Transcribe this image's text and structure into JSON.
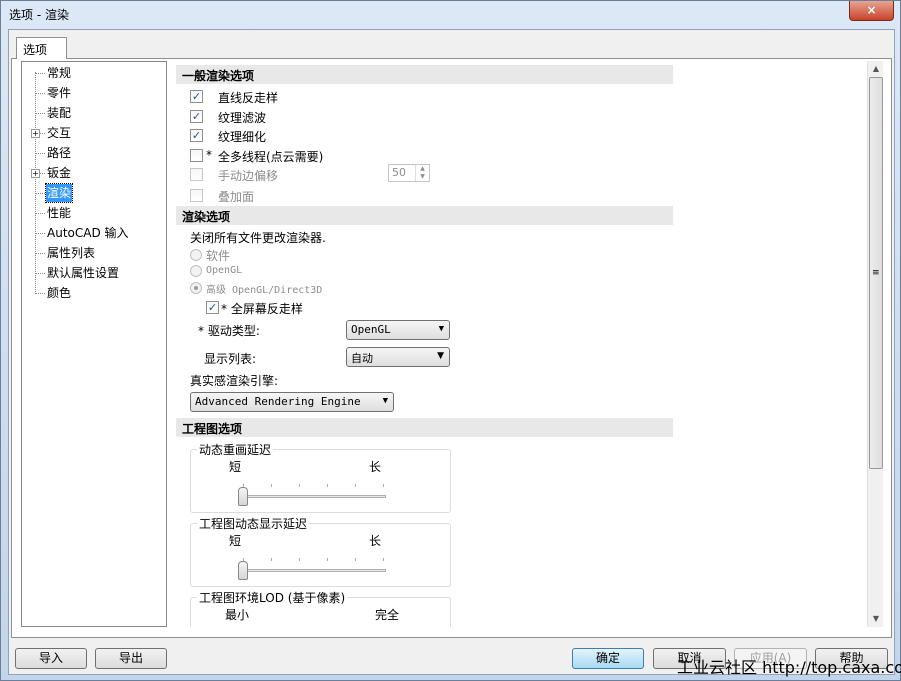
{
  "window": {
    "title": "选项 - 渲染",
    "close_icon": "×"
  },
  "tab": "选项",
  "tree": [
    {
      "label": "常规",
      "expandable": false
    },
    {
      "label": "零件",
      "expandable": false
    },
    {
      "label": "装配",
      "expandable": false
    },
    {
      "label": "交互",
      "expandable": true
    },
    {
      "label": "路径",
      "expandable": false
    },
    {
      "label": "钣金",
      "expandable": true
    },
    {
      "label": "渲染",
      "expandable": false,
      "selected": true
    },
    {
      "label": "性能",
      "expandable": false
    },
    {
      "label": "AutoCAD 输入",
      "expandable": false
    },
    {
      "label": "属性列表",
      "expandable": false
    },
    {
      "label": "默认属性设置",
      "expandable": false
    },
    {
      "label": "颜色",
      "expandable": false
    }
  ],
  "general": {
    "header": "一般渲染选项",
    "line_aa": {
      "label": "直线反走样",
      "checked": true
    },
    "tex_filter": {
      "label": "纹理滤波",
      "checked": true
    },
    "tex_refine": {
      "label": "纹理细化",
      "checked": true
    },
    "multithread": {
      "star": "*",
      "label": "全多线程(点云需要)",
      "checked": false
    },
    "manual_offset": {
      "label": "手动边偏移",
      "checked": false,
      "disabled": true,
      "value": "50"
    },
    "overlay": {
      "label": "叠加面",
      "checked": false,
      "disabled": true
    }
  },
  "render": {
    "header": "渲染选项",
    "note": "关闭所有文件更改渲染器.",
    "radios": [
      {
        "label": "软件",
        "selected": false
      },
      {
        "label": "OpenGL",
        "selected": false
      },
      {
        "label": "高级 OpenGL/Direct3D",
        "selected": true
      }
    ],
    "fullscreen_aa": {
      "label": "* 全屏幕反走样",
      "checked": true
    },
    "driver_label": "* 驱动类型:",
    "driver_value": "OpenGL",
    "display_list_label": "显示列表:",
    "display_list_value": "自动",
    "engine_label": "真实感渲染引擎:",
    "engine_value": "Advanced Rendering Engine"
  },
  "drawing": {
    "header": "工程图选项",
    "groups": [
      {
        "label": "动态重画延迟",
        "min": "短",
        "max": "长",
        "value": 0
      },
      {
        "label": "工程图动态显示延迟",
        "min": "短",
        "max": "长",
        "value": 0
      },
      {
        "label": "工程图环境LOD (基于像素)",
        "min": "最小",
        "max": "完全"
      }
    ]
  },
  "buttons": {
    "import": "导入",
    "export": "导出",
    "ok": "确定",
    "cancel": "取消",
    "apply": "应用(A)",
    "help": "帮助"
  },
  "watermark": "工业云社区 http://top.caxa.com/",
  "scroll": {
    "up": "▲",
    "down": "▼",
    "grip": "≡"
  }
}
